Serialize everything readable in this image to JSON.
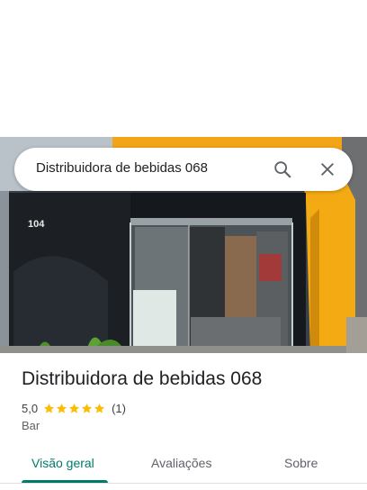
{
  "search": {
    "query": "Distribuidora de bebidas 068",
    "search_icon": "search-icon",
    "close_icon": "close-icon"
  },
  "place": {
    "title": "Distribuidora de bebidas 068",
    "rating": "5,0",
    "stars": 5,
    "review_count": "(1)",
    "category": "Bar",
    "photo_sign_number": "104"
  },
  "tabs": [
    {
      "label": "Visão geral",
      "active": true
    },
    {
      "label": "Avaliações",
      "active": false
    },
    {
      "label": "Sobre",
      "active": false
    }
  ],
  "colors": {
    "accent": "#00796b",
    "star": "#fbbc04",
    "storefront_yellow": "#f2a516"
  }
}
